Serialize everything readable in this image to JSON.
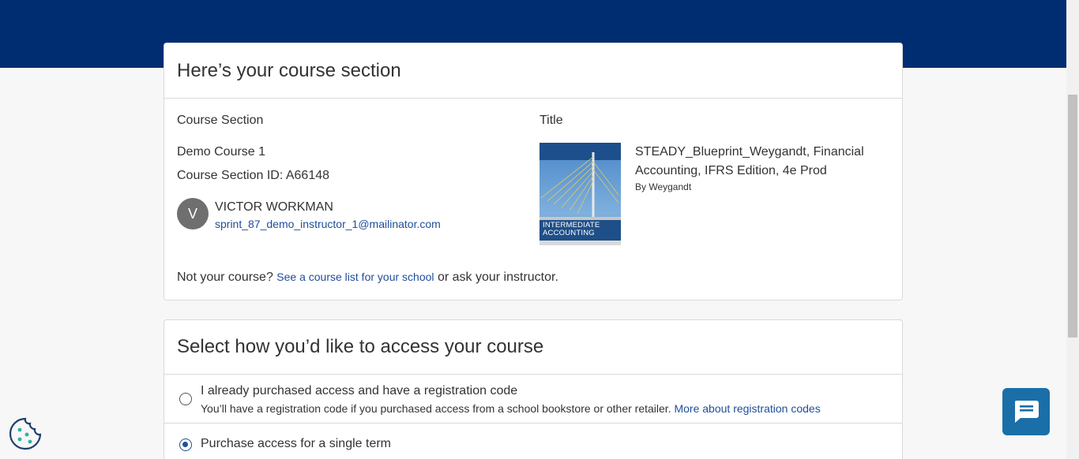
{
  "course_card": {
    "heading": "Here’s your course section",
    "course_section_label": "Course Section",
    "course_name": "Demo Course 1",
    "course_section_id": "Course Section ID: A66148",
    "instructor": {
      "initial": "V",
      "name": "VICTOR WORKMAN",
      "email": "sprint_87_demo_instructor_1@mailinator.com"
    },
    "title_label": "Title",
    "book": {
      "title": "STEADY_Blueprint_Weygandt, Financial Accounting, IFRS Edition, 4e Prod",
      "author": "By Weygandt",
      "cover_text": "INTERMEDIATE ACCOUNTING"
    },
    "not_your_course_prefix": "Not your course?",
    "course_list_link": "See a course list for your school",
    "not_your_course_suffix": "or ask your instructor."
  },
  "access_card": {
    "heading": "Select how you’d like to access your course",
    "options": [
      {
        "title": "I already purchased access and have a registration code",
        "description": "You’ll have a registration code if you purchased access from a school bookstore or other retailer.",
        "link": "More about registration codes",
        "selected": false
      },
      {
        "title": "Purchase access for a single term",
        "selected": true
      }
    ]
  },
  "colors": {
    "header_bg": "#002d72",
    "link": "#1f4e99",
    "chat_button": "#1a6fa8",
    "cookie_icon": "#1e3f6e"
  }
}
